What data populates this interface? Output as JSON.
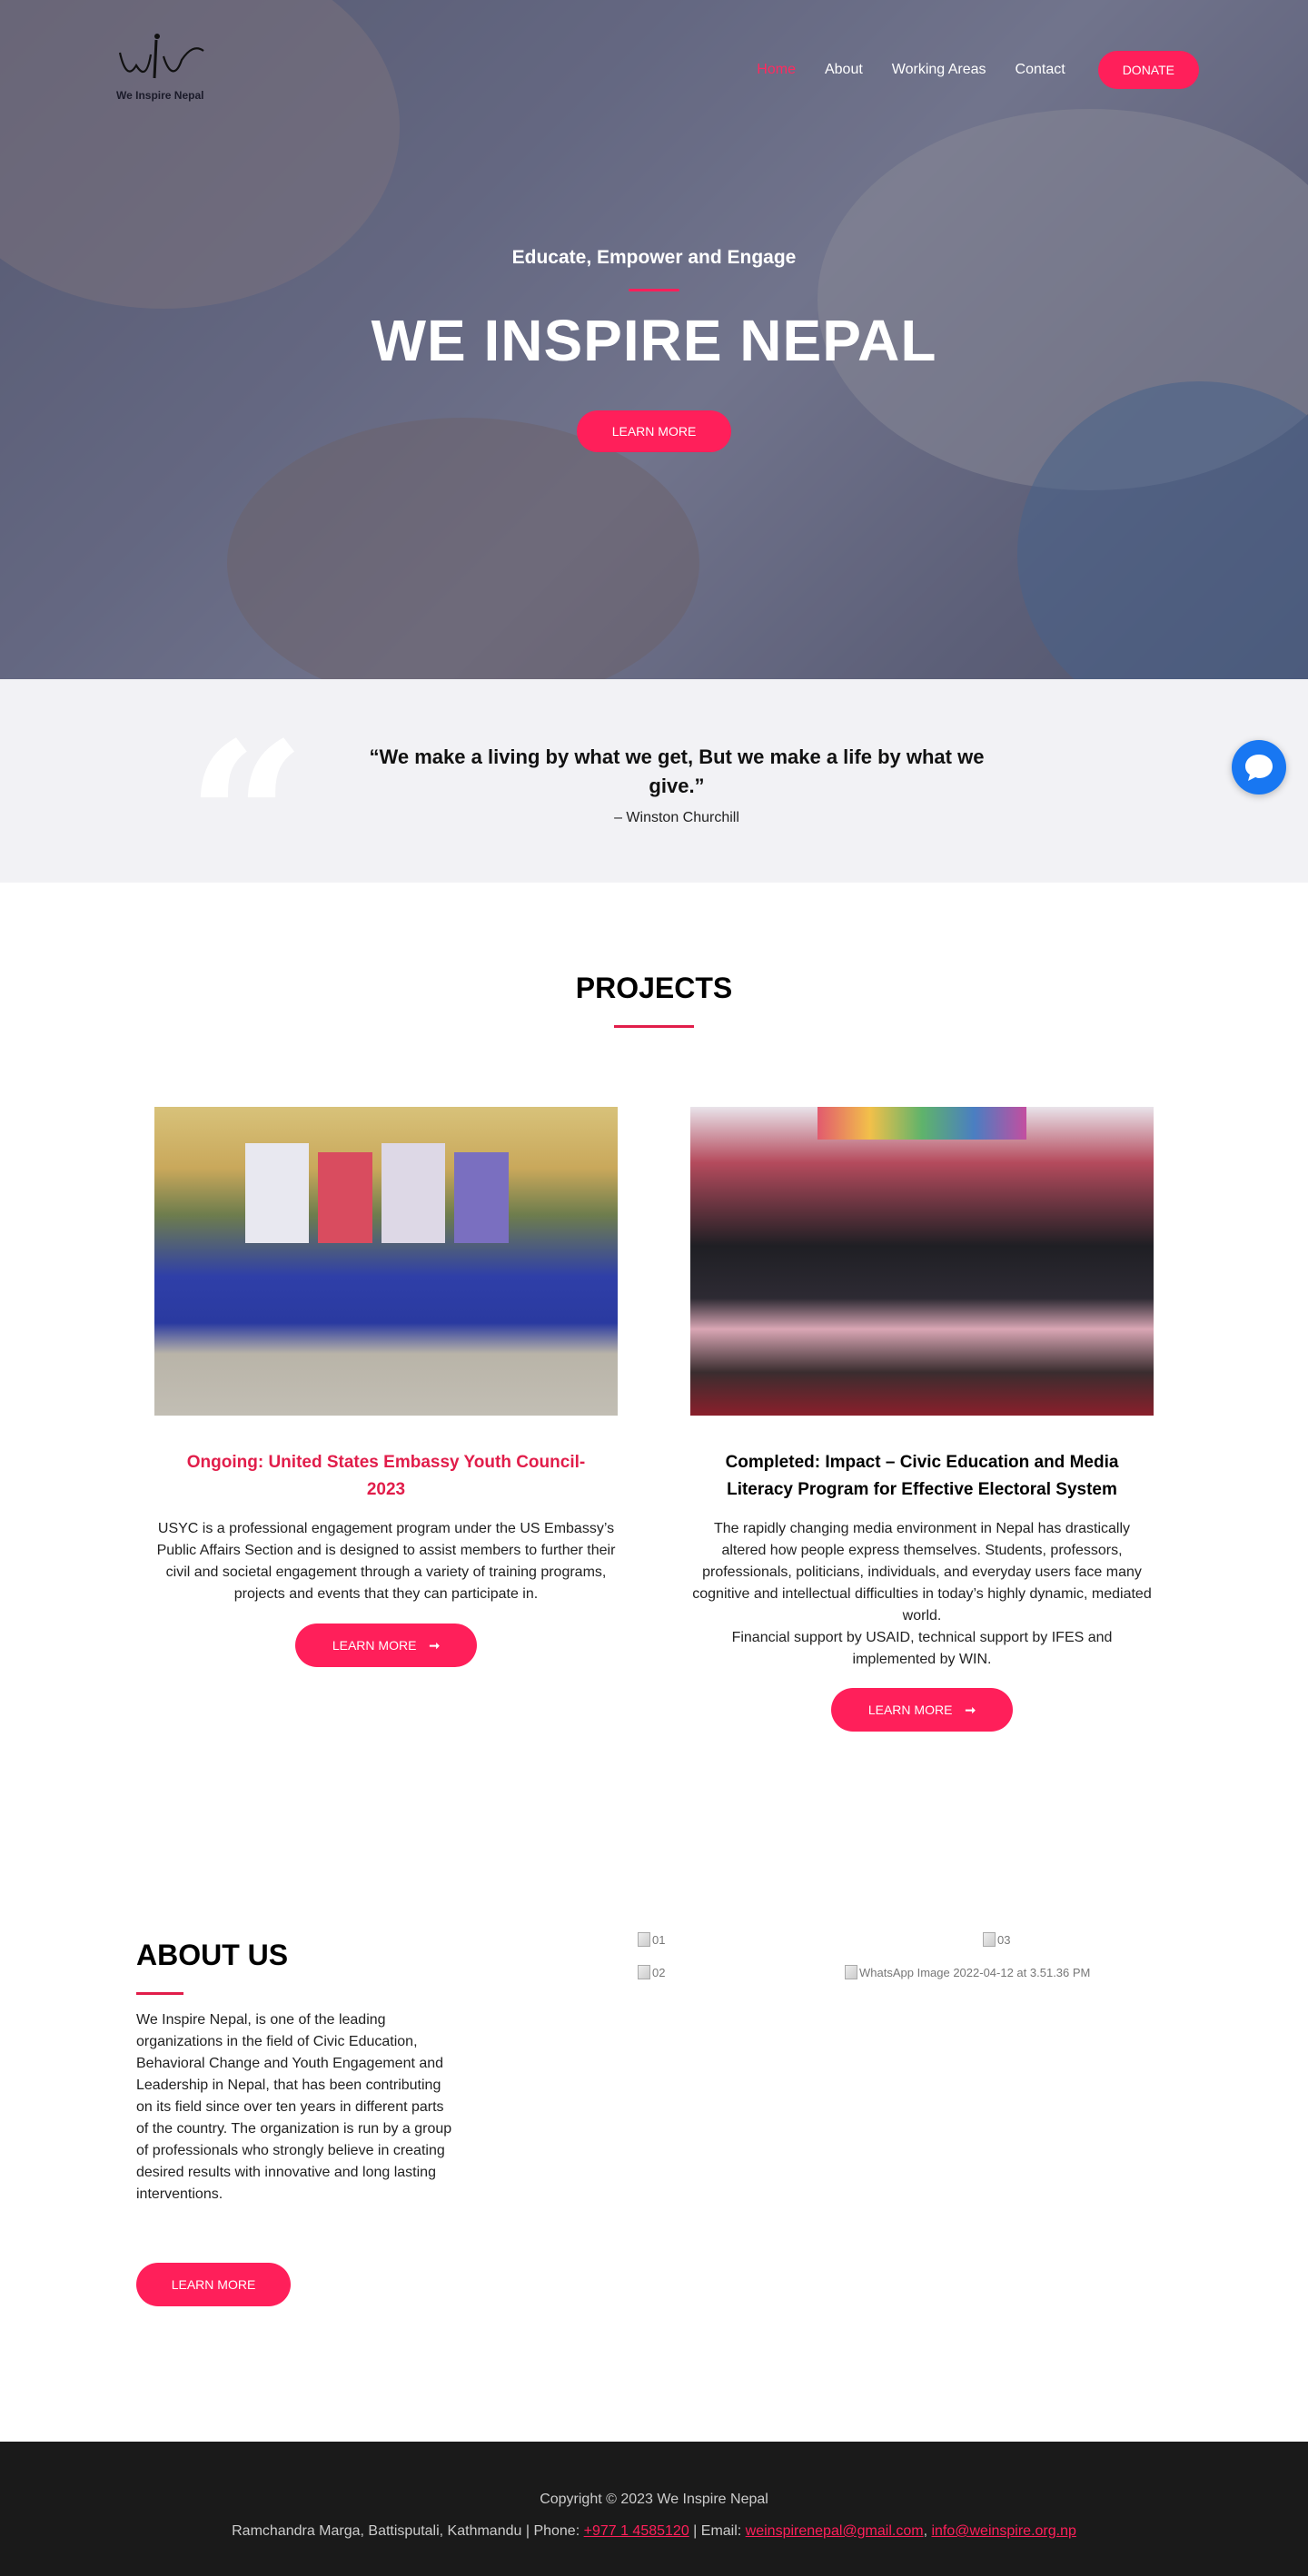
{
  "header": {
    "logo_text": "We Inspire Nepal",
    "nav": [
      "Home",
      "About",
      "Working Areas",
      "Contact"
    ],
    "donate_label": "DONATE"
  },
  "hero": {
    "subtitle": "Educate, Empower and Engage",
    "title": "WE INSPIRE NEPAL",
    "button_label": "LEARN MORE"
  },
  "quote": {
    "mark": "“",
    "text": "“We make a living by what we get, But we make a life by what we give.”",
    "author": "– Winston Churchill"
  },
  "projects": {
    "title": "PROJECTS",
    "items": [
      {
        "title": "Ongoing: United States Embassy Youth Council-2023",
        "description": "USYC is a professional engagement program under the US Embassy’s Public Affairs Section and is designed to assist members to further their civil and societal engagement through a variety of training programs, projects and events that they can participate in.",
        "button_label": "LEARN MORE"
      },
      {
        "title": "Completed: Impact – Civic Education and Media Literacy Program for Effective Electoral System",
        "description": "The rapidly changing media environment in Nepal has drastically altered how people express themselves. Students, professors, professionals, politicians, individuals, and everyday users face many cognitive and intellectual difficulties in today’s highly dynamic, mediated world.",
        "description_2": "Financial support by USAID, technical support by IFES and implemented by WIN.",
        "button_label": "LEARN MORE"
      }
    ]
  },
  "about": {
    "title": "ABOUT US",
    "text": "We Inspire Nepal, is one of the leading organizations in the field of Civic Education, Behavioral Change and Youth Engagement and Leadership in Nepal, that has been contributing on its field since over ten years in different parts of the country. The organization is run by a group of professionals who strongly believe in creating desired results with innovative and long lasting interventions.",
    "button_label": "LEARN MORE",
    "image_alts": [
      "01",
      "03",
      "02",
      "WhatsApp Image 2022-04-12 at 3.51.36 PM"
    ]
  },
  "footer": {
    "copyright": "Copyright © 2023 We Inspire Nepal",
    "address": "Ramchandra Marga, Battisputali, Kathmandu | Phone: ",
    "phone": "+977 1 4585120",
    "email_label": " | Email: ",
    "email1": "weinspirenepal@gmail.com",
    "sep": ", ",
    "email2": "info@weinspire.org.np"
  },
  "colors": {
    "accent": "#ff1f5a",
    "footer_bg": "#1a1a1a",
    "quote_bg": "#f2f2f5",
    "chat": "#1877f2"
  }
}
